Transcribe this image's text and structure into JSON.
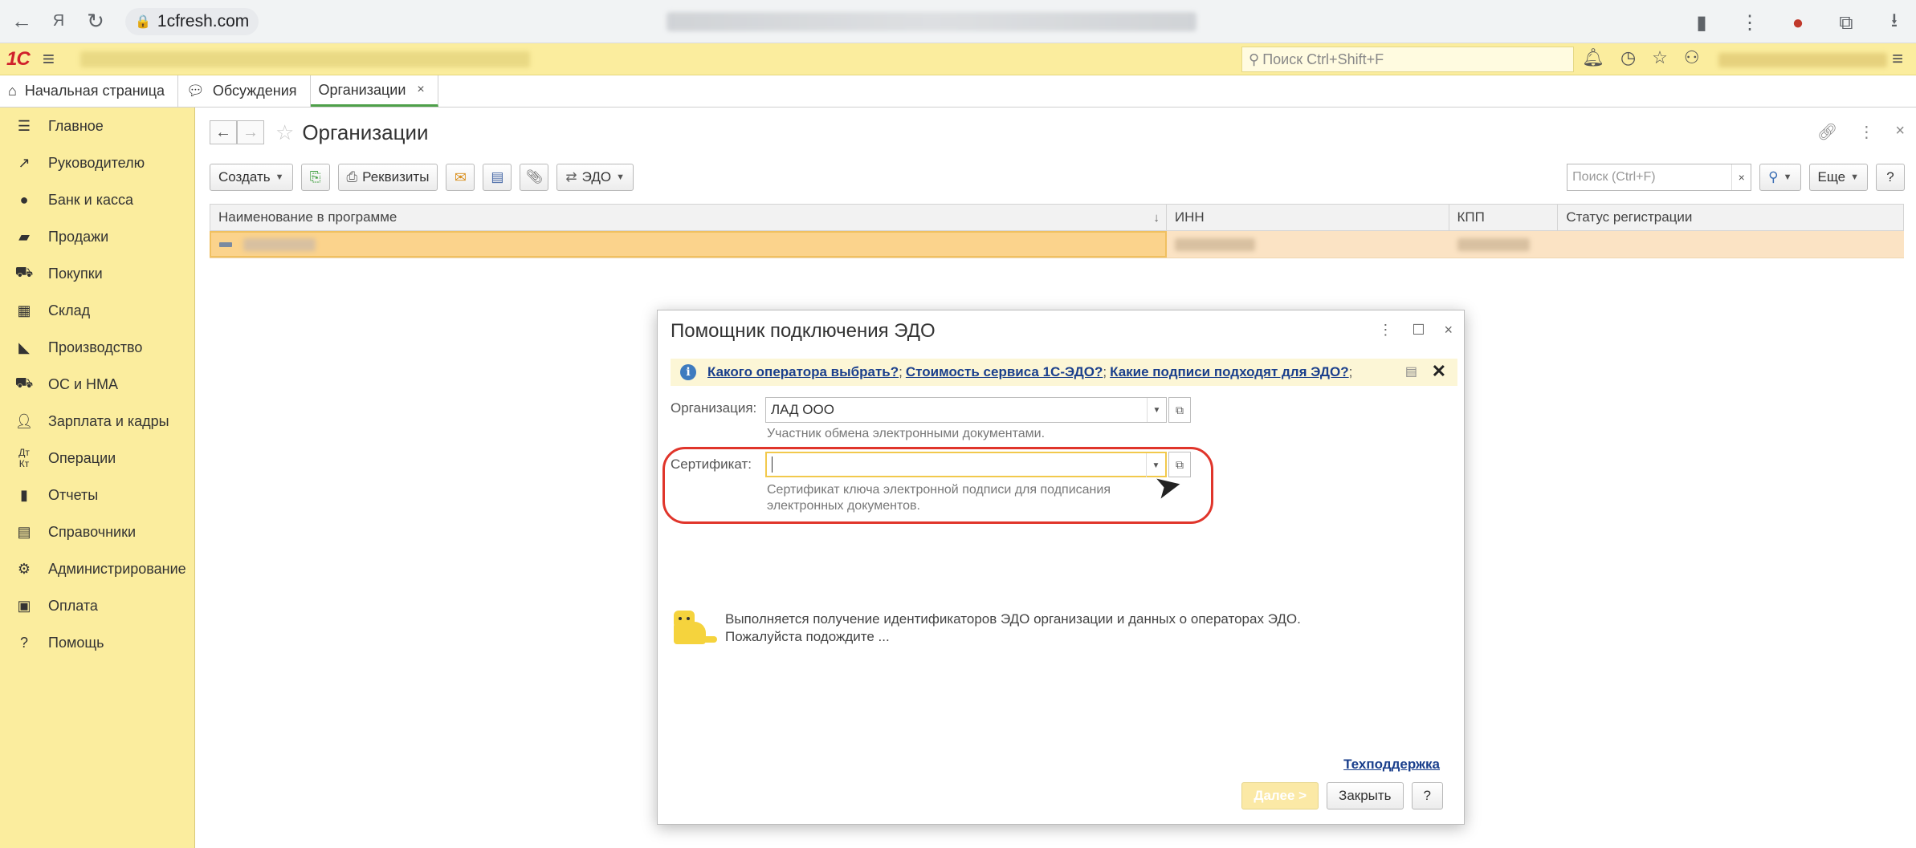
{
  "browser": {
    "url": "1cfresh.com",
    "back_icon": "arrow-left-icon",
    "yandex_icon": "yandex-icon",
    "reload_icon": "reload-icon"
  },
  "app": {
    "logo": "1С",
    "search_placeholder": "Поиск Ctrl+Shift+F"
  },
  "tabs": [
    {
      "label": "Начальная страница"
    },
    {
      "label": "Обсуждения"
    },
    {
      "label": "Организации"
    }
  ],
  "sidebar": {
    "items": [
      {
        "label": "Главное"
      },
      {
        "label": "Руководителю"
      },
      {
        "label": "Банк и касса"
      },
      {
        "label": "Продажи"
      },
      {
        "label": "Покупки"
      },
      {
        "label": "Склад"
      },
      {
        "label": "Производство"
      },
      {
        "label": "ОС и НМА"
      },
      {
        "label": "Зарплата и кадры"
      },
      {
        "label": "Операции"
      },
      {
        "label": "Отчеты"
      },
      {
        "label": "Справочники"
      },
      {
        "label": "Администрирование"
      },
      {
        "label": "Оплата"
      },
      {
        "label": "Помощь"
      }
    ]
  },
  "main": {
    "title": "Организации",
    "toolbar": {
      "create": "Создать",
      "requisites": "Реквизиты",
      "edo": "ЭДО",
      "search_placeholder": "Поиск (Ctrl+F)",
      "more": "Еще",
      "help": "?"
    },
    "grid": {
      "columns": [
        "Наименование в программе",
        "ИНН",
        "КПП",
        "Статус регистрации"
      ]
    }
  },
  "dialog": {
    "title": "Помощник подключения ЭДО",
    "info": {
      "link1": "Какого оператора выбрать?",
      "sep1": ";",
      "link2": "Стоимость сервиса 1С-ЭДО?",
      "sep2": ";",
      "link3": "Какие подписи подходят для ЭДО?",
      "sep3": ";"
    },
    "org_label": "Организация:",
    "org_value": "ЛАД ООО",
    "org_hint": "Участник обмена электронными документами.",
    "cert_label": "Сертификат:",
    "cert_value": "",
    "cert_hint_1": "Сертификат ключа электронной подписи для подписания",
    "cert_hint_2": "электронных документов.",
    "wait_line1": "Выполняется получение идентификаторов ЭДО организации и данных о операторах ЭДО.",
    "wait_line2": "Пожалуйста подождите ...",
    "support_link": "Техподдержка",
    "next_button": "Далее >",
    "close_button": "Закрыть",
    "help_button": "?"
  }
}
